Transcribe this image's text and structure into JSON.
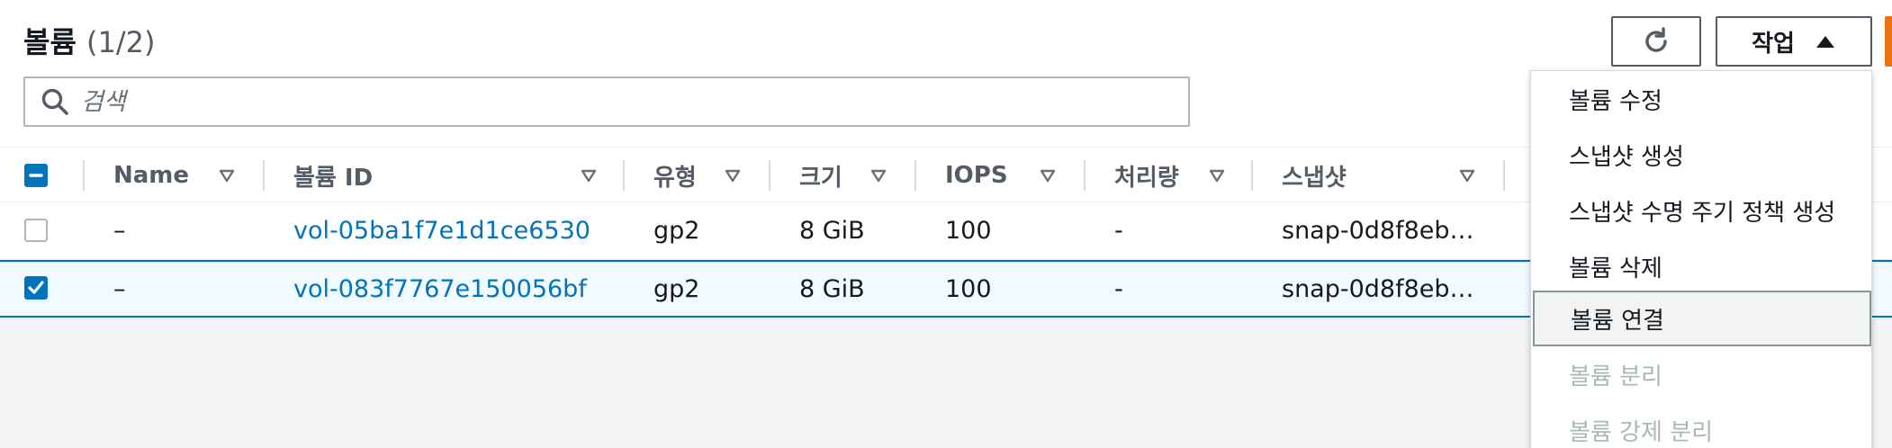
{
  "header": {
    "title": "볼륨",
    "count": "(1/2)",
    "refresh_icon": "refresh-icon",
    "actions_label": "작업",
    "actions_icon": "caret-up-icon"
  },
  "search": {
    "placeholder": "검색",
    "icon": "search-icon"
  },
  "table": {
    "columns": [
      {
        "label": "Name"
      },
      {
        "label": "볼륨 ID"
      },
      {
        "label": "유형"
      },
      {
        "label": "크기"
      },
      {
        "label": "IOPS"
      },
      {
        "label": "처리량"
      },
      {
        "label": "스냅샷"
      }
    ],
    "rows": [
      {
        "selected": false,
        "name": "–",
        "volume_id": "vol-05ba1f7e1d1ce6530",
        "type": "gp2",
        "size": "8 GiB",
        "iops": "100",
        "throughput": "-",
        "snapshot": "snap-0d8f8eb…"
      },
      {
        "selected": true,
        "name": "–",
        "volume_id": "vol-083f7767e150056bf",
        "type": "gp2",
        "size": "8 GiB",
        "iops": "100",
        "throughput": "-",
        "snapshot": "snap-0d8f8eb…"
      }
    ]
  },
  "menu": {
    "items": [
      {
        "label": "볼륨 수정",
        "state": "enabled"
      },
      {
        "label": "스냅샷 생성",
        "state": "enabled"
      },
      {
        "label": "스냅샷 수명 주기 정책 생성",
        "state": "enabled"
      },
      {
        "label": "볼륨 삭제",
        "state": "enabled"
      },
      {
        "label": "볼륨 연결",
        "state": "highlighted"
      },
      {
        "label": "볼륨 분리",
        "state": "disabled"
      },
      {
        "label": "볼륨 강제 분리",
        "state": "disabled"
      }
    ]
  },
  "colors": {
    "link": "#0073bb",
    "primary_orange": "#ec7211",
    "selected_row_bg": "#f1faff"
  }
}
